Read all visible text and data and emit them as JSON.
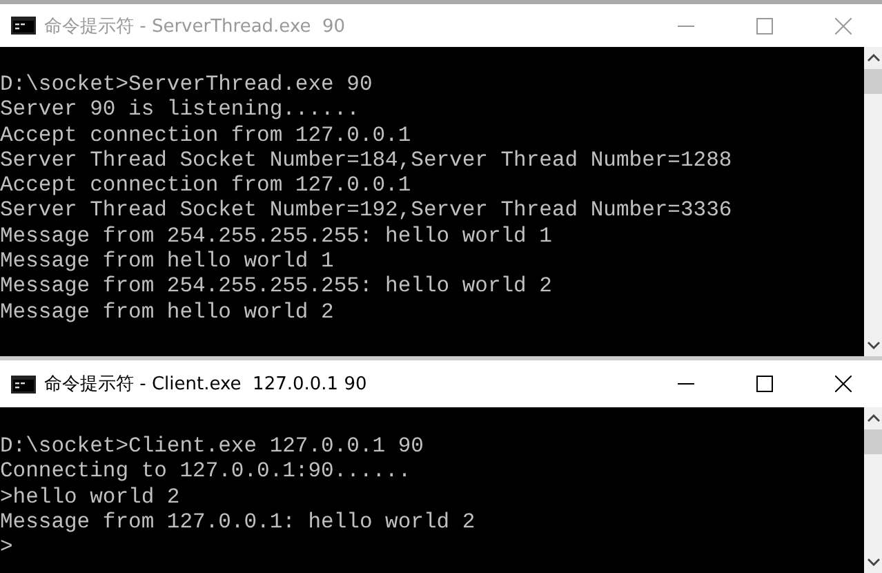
{
  "windows": [
    {
      "title": "命令提示符 - ServerThread.exe  90",
      "active": false,
      "lines": [
        "D:\\socket>ServerThread.exe 90",
        "Server 90 is listening......",
        "Accept connection from 127.0.0.1",
        "Server Thread Socket Number=184,Server Thread Number=1288",
        "Accept connection from 127.0.0.1",
        "Server Thread Socket Number=192,Server Thread Number=3336",
        "Message from 254.255.255.255: hello world 1",
        "Message from hello world 1",
        "Message from 254.255.255.255: hello world 2",
        "Message from hello world 2"
      ]
    },
    {
      "title": "命令提示符 - Client.exe  127.0.0.1 90",
      "active": true,
      "lines": [
        "D:\\socket>Client.exe 127.0.0.1 90",
        "Connecting to 127.0.0.1:90......",
        ">hello world 2",
        "Message from 127.0.0.1: hello world 2",
        ">"
      ]
    }
  ]
}
